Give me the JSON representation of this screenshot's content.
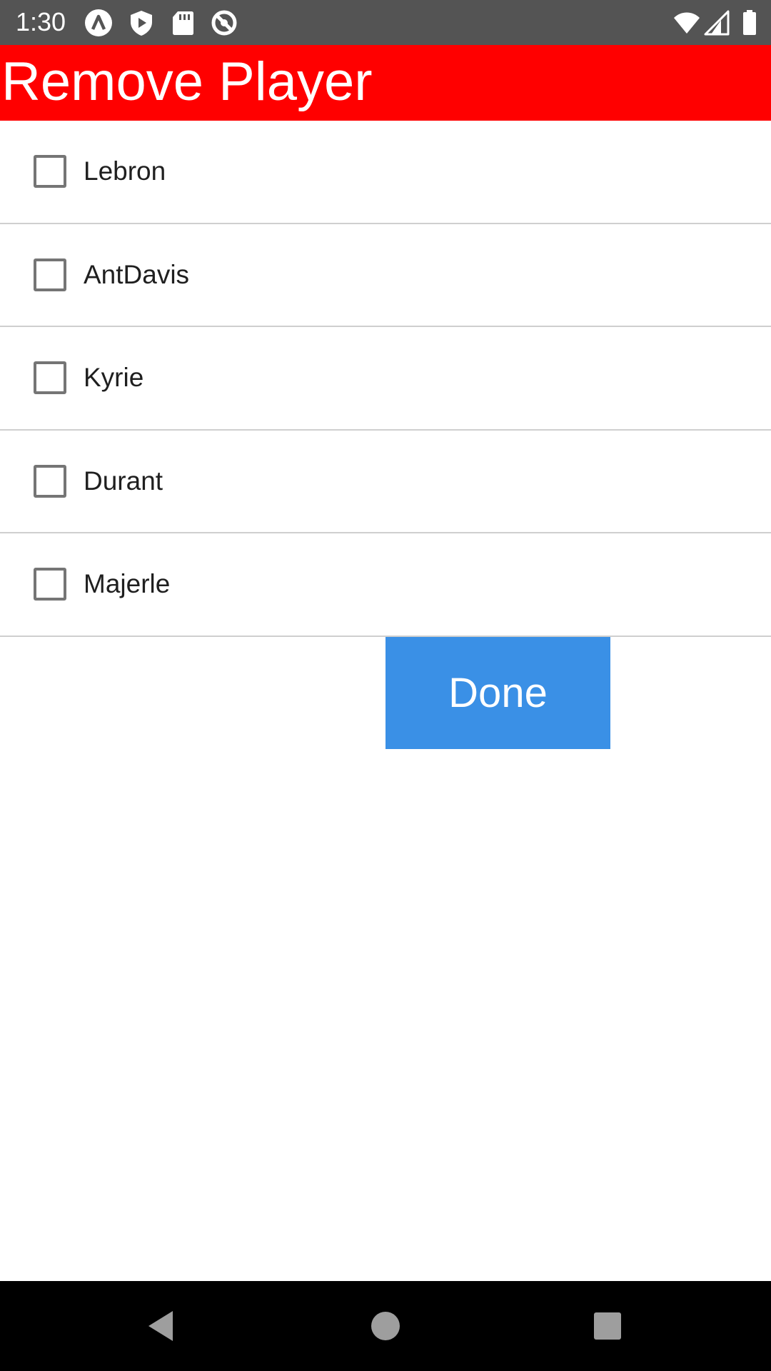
{
  "status_bar": {
    "time": "1:30",
    "icons": [
      "app-a-icon",
      "shield-play-icon",
      "sd-card-icon",
      "no-sync-icon",
      "wifi-icon",
      "signal-icon",
      "battery-icon"
    ]
  },
  "app_bar": {
    "title": "Remove Player",
    "background_color": "#ff0000"
  },
  "players": [
    {
      "name": "Lebron",
      "checked": false
    },
    {
      "name": "AntDavis",
      "checked": false
    },
    {
      "name": "Kyrie",
      "checked": false
    },
    {
      "name": "Durant",
      "checked": false
    },
    {
      "name": "Majerle",
      "checked": false
    }
  ],
  "done_button": {
    "label": "Done",
    "color": "#3a90e6"
  },
  "nav_bar": {
    "icons": [
      "back-icon",
      "home-icon",
      "recents-icon"
    ]
  }
}
